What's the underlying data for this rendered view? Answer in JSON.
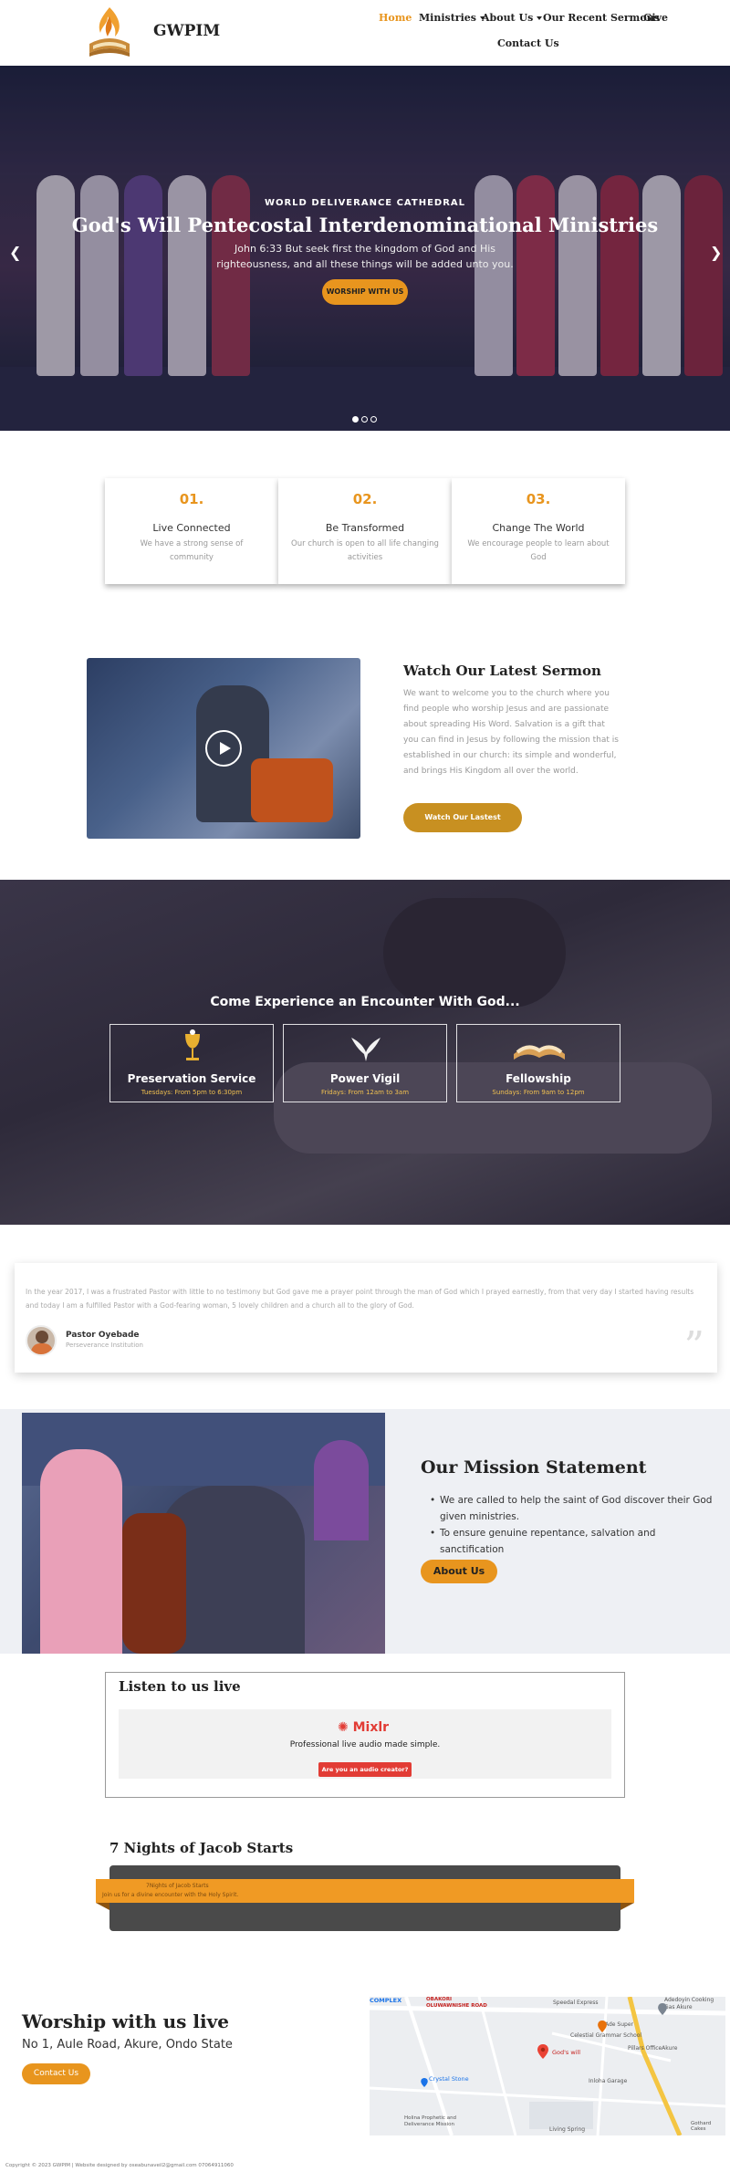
{
  "header": {
    "brand": "GWPIM",
    "nav": {
      "home": "Home",
      "ministries": "Ministries",
      "about": "About Us",
      "sermons": "Our Recent Sermons",
      "give": "Give",
      "contact": "Contact Us"
    }
  },
  "hero": {
    "subtitle": "WORLD DELIVERANCE CATHEDRAL",
    "title": "God's Will Pentecostal Interdenominational Ministries",
    "verse": "John 6:33 But seek first the kingdom of God and His righteousness, and all these things will be added unto you.",
    "button": "WORSHIP WITH US",
    "slides": 3,
    "active_slide": 1
  },
  "features": [
    {
      "num": "01.",
      "title": "Live Connected",
      "desc": "We have a strong sense of community"
    },
    {
      "num": "02.",
      "title": "Be Transformed",
      "desc": "Our church is open to all life changing activities"
    },
    {
      "num": "03.",
      "title": "Change The World",
      "desc": "We encourage people to learn about God"
    }
  ],
  "sermon": {
    "title": "Watch Our Latest Sermon",
    "text": "We want to welcome you to the church where you find people who worship Jesus and are passionate about spreading His Word. Salvation is a gift that you can find in Jesus by following the mission that is established in our church: its simple and wonderful, and brings His Kingdom all over the world.",
    "button": "Watch Our Lastest Messages"
  },
  "encounter": {
    "title": "Come Experience an Encounter With God...",
    "services": [
      {
        "name": "Preservation Service",
        "time": "Tuesdays: From 5pm to 6:30pm",
        "icon": "chalice-icon"
      },
      {
        "name": "Power Vigil",
        "time": "Fridays: From 12am to 3am",
        "icon": "dove-icon"
      },
      {
        "name": "Fellowship",
        "time": "Sundays: From 9am to 12pm",
        "icon": "bible-icon"
      }
    ]
  },
  "testimonial": {
    "text": "In the year 2017, I was a frustrated Pastor with little to no testimony but God gave me a prayer point through the man of God which I prayed earnestly, from that very day I started having results and today I am a fulfilled Pastor with a God-fearing woman, 5 lovely children and a church all to the glory of God.",
    "name": "Pastor Oyebade",
    "role": "Perseverance Institution"
  },
  "mission": {
    "title": "Our Mission Statement",
    "items": [
      "We are called to help the saint of God discover their God given ministries.",
      "To ensure genuine repentance, salvation and sanctification"
    ],
    "button": "About Us"
  },
  "listen": {
    "title": "Listen to us live",
    "logo": "Mixlr",
    "tagline": "Professional live audio made simple.",
    "button": "Are you an audio creator?"
  },
  "jacob": {
    "title": "7 Nights of Jacob Starts",
    "line1": "7Nights of Jacob Starts",
    "line2": "Join us for a divine encounter with the Holy Spirit."
  },
  "worship": {
    "title": "Worship with us live",
    "address": "No 1, Aule Road, Akure, Ondo State",
    "button": "Contact Us"
  },
  "map": {
    "labels": [
      "COMPLEX",
      "OBAKORI OLUWAWNISHE ROAD",
      "Speedal Express",
      "Adedoyin Cooking Gas Akure",
      "Ade Super",
      "Celestial Grammar School",
      "Pillars OfficeAkure",
      "God's will",
      "Crystal Stone",
      "Inloha Garage",
      "Holina Prophetic and Deliverance Mission",
      "Living Spring",
      "Gothard Cakes"
    ]
  },
  "footer": {
    "copyright": "Copyright © 2023 GWPIM | Website designed by oseabunaveil2@gmail.com 07064911060"
  },
  "colors": {
    "accent": "#e8951e",
    "dark": "#222222",
    "mixlr": "#e23c35"
  }
}
